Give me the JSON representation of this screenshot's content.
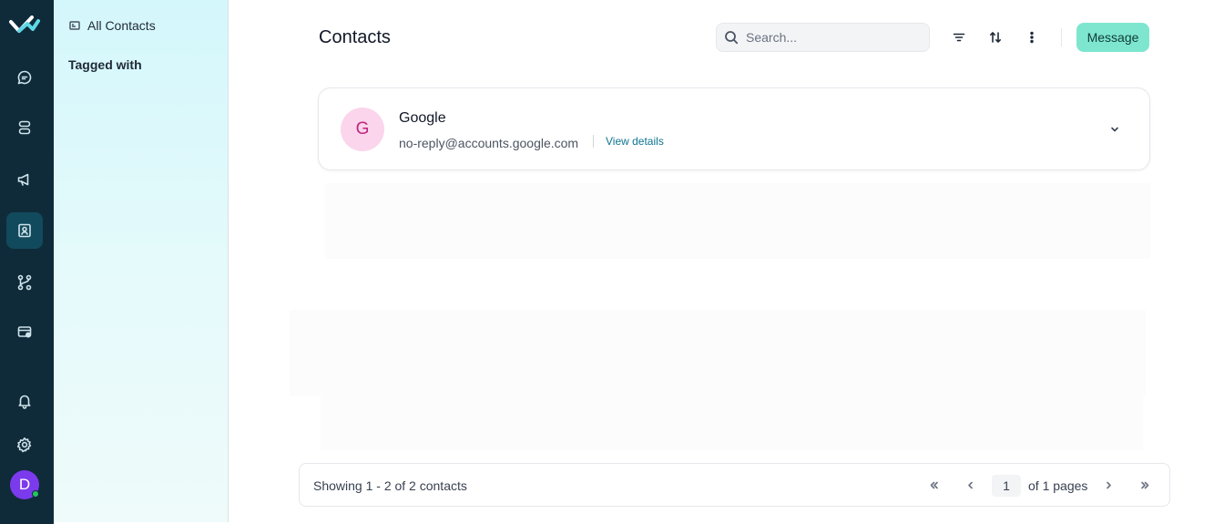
{
  "rail": {
    "items": [
      {
        "icon": "chat-bubble-icon",
        "active": false
      },
      {
        "icon": "database-icon",
        "active": false
      },
      {
        "icon": "megaphone-icon",
        "active": false
      },
      {
        "icon": "contact-card-icon",
        "active": true
      },
      {
        "icon": "workflow-icon",
        "active": false
      },
      {
        "icon": "wallet-icon",
        "active": false
      },
      {
        "icon": "bell-icon",
        "active": false
      },
      {
        "icon": "gear-icon",
        "active": false
      }
    ],
    "avatar_initial": "D",
    "avatar_color": "#7c3aed",
    "status_color": "#22c55e"
  },
  "subnav": {
    "all_contacts": "All Contacts",
    "tagged_with": "Tagged with"
  },
  "header": {
    "title": "Contacts",
    "search_placeholder": "Search...",
    "message_label": "Message"
  },
  "contacts": [
    {
      "initial": "G",
      "name": "Google",
      "email": "no-reply@accounts.google.com",
      "link_label": "View details"
    }
  ],
  "footer": {
    "showing": "Showing 1 - 2 of 2 contacts",
    "current_page": "1",
    "total_pages": "of 1 pages"
  },
  "colors": {
    "rail_bg": "#0f2b3a",
    "accent": "#7ee6cf",
    "link": "#0e7490",
    "avatar_bg": "#fbd5ec"
  }
}
